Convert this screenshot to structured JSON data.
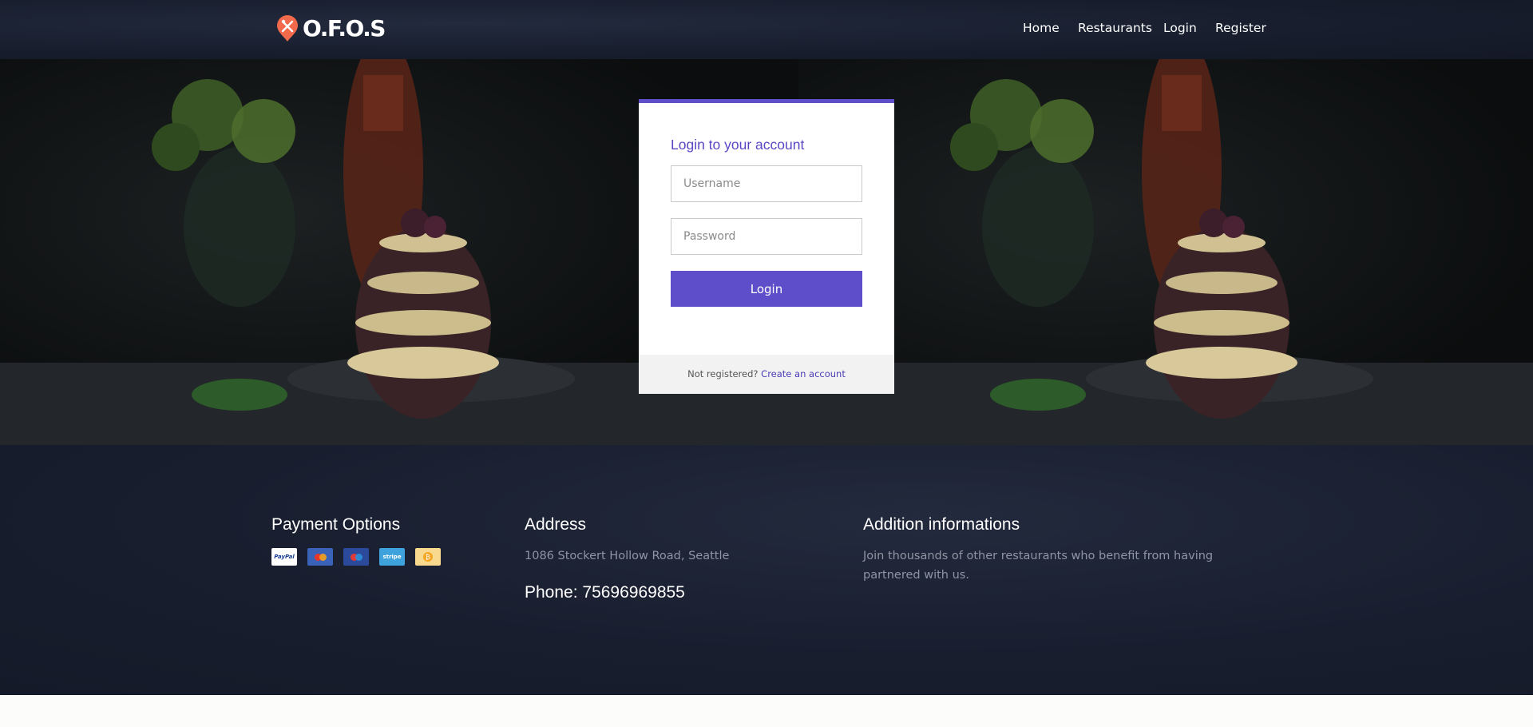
{
  "brand": {
    "name": "O.F.O.S",
    "logo_icon": "utensils-pin-icon",
    "accent": "#f26a4b"
  },
  "nav": {
    "home": "Home",
    "restaurants": "Restaurants",
    "login": "Login",
    "register": "Register"
  },
  "login_card": {
    "title": "Login to your account",
    "username_placeholder": "Username",
    "password_placeholder": "Password",
    "submit_label": "Login",
    "footer_text": "Not registered?",
    "footer_link": "Create an account",
    "accent_color": "#5f4ec9"
  },
  "footer": {
    "payment": {
      "heading": "Payment Options",
      "methods": [
        {
          "icon": "paypal-icon",
          "label": "PayPal"
        },
        {
          "icon": "mastercard-icon",
          "label": ""
        },
        {
          "icon": "maestro-icon",
          "label": ""
        },
        {
          "icon": "stripe-icon",
          "label": "stripe"
        },
        {
          "icon": "bitcoin-icon",
          "label": ""
        }
      ]
    },
    "address": {
      "heading": "Address",
      "line": "1086 Stockert Hollow Road, Seattle",
      "phone": "Phone: 75696969855"
    },
    "additional": {
      "heading": "Addition informations",
      "text": "Join thousands of other restaurants who benefit from having partnered with us."
    }
  }
}
